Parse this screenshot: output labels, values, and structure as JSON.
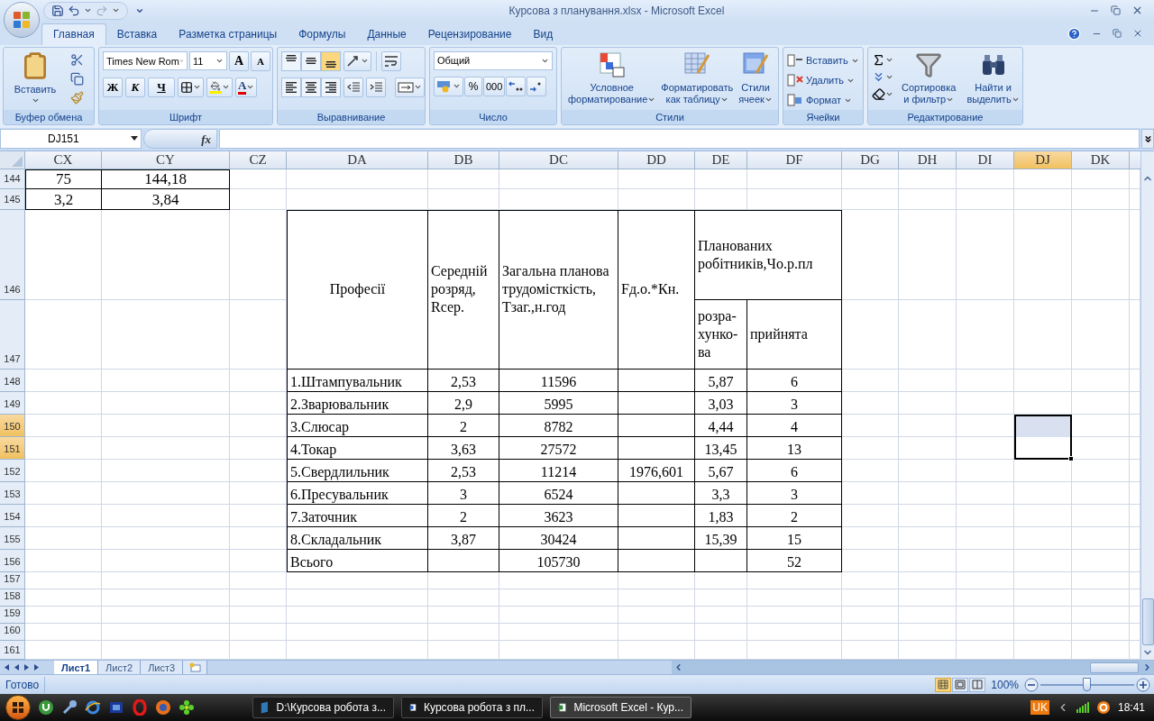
{
  "title_bar": {
    "title": "Курсова з планування.xlsx - Microsoft Excel"
  },
  "ribbon_tabs": [
    {
      "label": "Главная",
      "selected": true
    },
    {
      "label": "Вставка",
      "selected": false
    },
    {
      "label": "Разметка страницы",
      "selected": false
    },
    {
      "label": "Формулы",
      "selected": false
    },
    {
      "label": "Данные",
      "selected": false
    },
    {
      "label": "Рецензирование",
      "selected": false
    },
    {
      "label": "Вид",
      "selected": false
    }
  ],
  "clipboard": {
    "paste": "Вставить",
    "group": "Буфер обмена"
  },
  "font": {
    "name": "Times New Rom",
    "size": "11",
    "grow": "A",
    "shrink": "A",
    "bold": "Ж",
    "italic": "К",
    "underline": "Ч",
    "font_color_label": "A",
    "group": "Шрифт"
  },
  "alignment": {
    "group": "Выравнивание",
    "vertical": [
      {
        "kind": "top",
        "selected": false
      },
      {
        "kind": "middle",
        "selected": false
      },
      {
        "kind": "bottom",
        "selected": true
      }
    ]
  },
  "number": {
    "format": "Общий",
    "percent": "%",
    "thousands": "000",
    "group": "Число"
  },
  "styles": {
    "group": "Стили",
    "buttons": [
      {
        "kind": "conditional",
        "lines": [
          "Условное",
          "форматирование"
        ]
      },
      {
        "kind": "table",
        "lines": [
          "Форматировать",
          "как таблицу"
        ]
      },
      {
        "kind": "cell",
        "lines": [
          "Стили",
          "ячеек"
        ]
      }
    ]
  },
  "cells": {
    "group": "Ячейки",
    "buttons": [
      {
        "kind": "insert",
        "label": "Вставить"
      },
      {
        "kind": "delete",
        "label": "Удалить"
      },
      {
        "kind": "format",
        "label": "Формат"
      }
    ]
  },
  "editing": {
    "group": "Редактирование",
    "buttons": [
      {
        "kind": "sort",
        "lines": [
          "Сортировка",
          "и фильтр"
        ]
      },
      {
        "kind": "find",
        "lines": [
          "Найти и",
          "выделить"
        ]
      }
    ]
  },
  "formula_bar": {
    "name_box": "DJ151",
    "fx": "fx"
  },
  "columns": [
    {
      "label": "CX",
      "selected": false
    },
    {
      "label": "CY",
      "selected": false
    },
    {
      "label": "CZ",
      "selected": false
    },
    {
      "label": "DA",
      "selected": false
    },
    {
      "label": "DB",
      "selected": false
    },
    {
      "label": "DC",
      "selected": false
    },
    {
      "label": "DD",
      "selected": false
    },
    {
      "label": "DE",
      "selected": false
    },
    {
      "label": "DF",
      "selected": false
    },
    {
      "label": "DG",
      "selected": false
    },
    {
      "label": "DH",
      "selected": false
    },
    {
      "label": "DI",
      "selected": false
    },
    {
      "label": "DJ",
      "selected": true
    },
    {
      "label": "DK",
      "selected": false
    }
  ],
  "rows": [
    {
      "label": "144",
      "selected": false
    },
    {
      "label": "145",
      "selected": false
    },
    {
      "label": "146",
      "selected": false
    },
    {
      "label": "147",
      "selected": false
    },
    {
      "label": "148",
      "selected": false
    },
    {
      "label": "149",
      "selected": false
    },
    {
      "label": "150",
      "selected": true,
      "active": false
    },
    {
      "label": "151",
      "selected": true,
      "active": true
    },
    {
      "label": "152",
      "selected": false
    },
    {
      "label": "153",
      "selected": false
    },
    {
      "label": "154",
      "selected": false
    },
    {
      "label": "155",
      "selected": false
    },
    {
      "label": "156",
      "selected": false
    },
    {
      "label": "157",
      "selected": false
    },
    {
      "label": "158",
      "selected": false
    },
    {
      "label": "159",
      "selected": false
    },
    {
      "label": "160",
      "selected": false
    },
    {
      "label": "161",
      "selected": false
    }
  ],
  "summary_table": [
    [
      "75",
      "144,18"
    ],
    [
      "3,2",
      "3,84"
    ]
  ],
  "staffing_table": {
    "headers": [
      "Професії",
      "Середній розряд, Rсер.",
      "Загальна планова трудомісткість, Тзаг.,н.год",
      "Fд.о.*Кн.",
      "Планованих робітників,Чо.р.пл"
    ],
    "subheaders": [
      "розра-хунко-ва",
      "прийнята"
    ],
    "rows": [
      {
        "profession": "1.Штампувальник",
        "avg_grade": "2,53",
        "labor": "11596",
        "calculated": "5,87",
        "accepted": "6"
      },
      {
        "profession": "2.Зварювальник",
        "avg_grade": "2,9",
        "labor": "5995",
        "calculated": "3,03",
        "accepted": "3"
      },
      {
        "profession": "3.Слюсар",
        "avg_grade": "2",
        "labor": "8782",
        "calculated": "4,44",
        "accepted": "4"
      },
      {
        "profession": "4.Токар",
        "avg_grade": "3,63",
        "labor": "27572",
        "calculated": "13,45",
        "accepted": "13"
      },
      {
        "profession": "5.Свердлильник",
        "avg_grade": "2,53",
        "labor": "11214",
        "fund": "1976,601",
        "calculated": "5,67",
        "accepted": "6"
      },
      {
        "profession": "6.Пресувальник",
        "avg_grade": "3",
        "labor": "6524",
        "calculated": "3,3",
        "accepted": "3"
      },
      {
        "profession": "7.Заточник",
        "avg_grade": "2",
        "labor": "3623",
        "calculated": "1,83",
        "accepted": "2"
      },
      {
        "profession": "8.Складальник",
        "avg_grade": "3,87",
        "labor": "30424",
        "calculated": "15,39",
        "accepted": "15"
      }
    ],
    "total": {
      "profession": "Всього",
      "labor": "105730",
      "accepted": "52"
    }
  },
  "sheet_tabs": [
    {
      "label": "Лист1",
      "selected": true
    },
    {
      "label": "Лист2",
      "selected": false
    },
    {
      "label": "Лист3",
      "selected": false
    }
  ],
  "status_bar": {
    "status": "Готово",
    "views": [
      {
        "kind": "normal",
        "selected": true
      },
      {
        "kind": "layout",
        "selected": false
      },
      {
        "kind": "pagebreak",
        "selected": false
      }
    ],
    "zoom": "100%",
    "zoom_slider": {
      "level": 0.5
    }
  },
  "taskbar": {
    "tasks": [
      {
        "kind": "folder",
        "label": "D:\\Курсова робота з...",
        "selected": false
      },
      {
        "kind": "word",
        "label": "Курсова робота з пл...",
        "selected": false
      },
      {
        "kind": "excel",
        "label": "Microsoft Excel - Кур...",
        "selected": true
      }
    ],
    "language": "UK",
    "clock": "18:41"
  }
}
